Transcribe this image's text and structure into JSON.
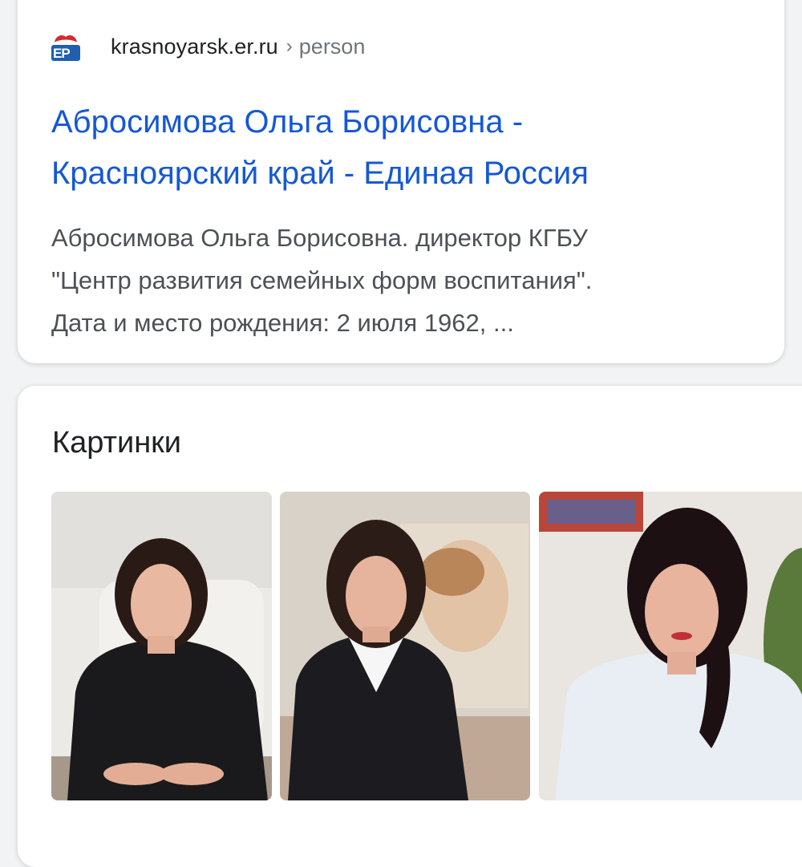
{
  "result": {
    "favicon_text": "ЕР",
    "site": "krasnoyarsk.er.ru",
    "separator": "›",
    "path": "person",
    "title_line1": "Абросимова Ольга Борисовна -",
    "title_line2": "Красноярский край - Единая Россия",
    "snippet_line1": "Абросимова Ольга Борисовна. директор КГБУ",
    "snippet_line2": "\"Центр развития семейных форм воспитания\".",
    "snippet_line3": "Дата и место рождения: 2 июля 1962, ..."
  },
  "images": {
    "heading": "Картинки",
    "thumbnails": [
      {
        "icon": "portrait-photo"
      },
      {
        "icon": "portrait-photo"
      },
      {
        "icon": "portrait-photo"
      }
    ]
  },
  "colors": {
    "link": "#1558d6",
    "snippet": "#4d5156",
    "url": "#202124",
    "path": "#70757a",
    "background": "#f1f3f4"
  }
}
